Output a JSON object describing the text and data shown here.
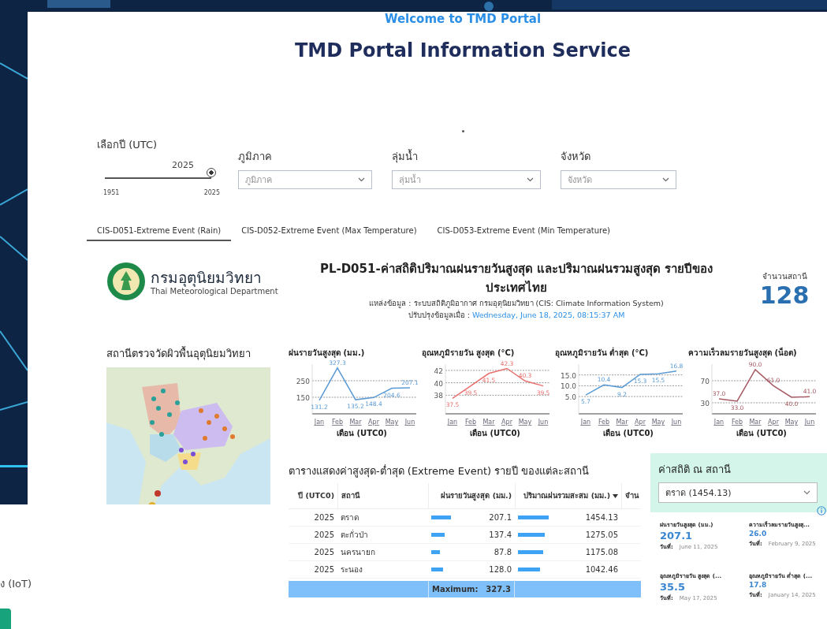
{
  "header": {
    "welcome": "Welcome to TMD Portal",
    "title": "TMD Portal Information Service"
  },
  "year_filter": {
    "label": "เลือกปี (UTC)",
    "value": "2025",
    "min": "1951",
    "max": "2025",
    "level": 1
  },
  "filters": [
    {
      "label": "ภูมิภาค",
      "placeholder": "ภูมิภาค"
    },
    {
      "label": "ลุ่มน้ำ",
      "placeholder": "ลุ่มน้ำ"
    },
    {
      "label": "จังหวัด",
      "placeholder": "จังหวัด"
    }
  ],
  "tabs": [
    {
      "label": "CIS-D051-Extreme Event (Rain)",
      "selected": true
    },
    {
      "label": "CIS-D052-Extreme Event (Max Temperature)",
      "selected": false
    },
    {
      "label": "CIS-D053-Extreme Event (Min Temperature)",
      "selected": false
    }
  ],
  "report": {
    "org_name": "กรมอุตุนิยมวิทยา",
    "org_name_en": "Thai Meteorological Department",
    "title": "PL-D051-ค่าสถิติปริมาณฝนรายวันสูงสุด และปริมาณฝนรวมสูงสุด รายปีของประเทศไทย",
    "source": "แหล่งข้อมูล : ระบบสถิติภูมิอากาศ กรมอุตุนิยมวิทยา (CIS: Climate Information System)",
    "updated_label": "ปรับปรุงข้อมูลเมื่อ :",
    "updated": "Wednesday, June 18, 2025, 08:15:37 AM",
    "station_count_label": "จำนวนสถานี",
    "station_count": "128"
  },
  "map": {
    "title": "สถานีตรวจวัดผิวพื้นอุตุนิยมวิทยา",
    "kind": "picture"
  },
  "charts": [
    {
      "chart_data": {
        "type": "line",
        "title": "ฝนรายวันสูงสุด (มม.)",
        "xlabel": "เดือน (UTC0)",
        "categories": [
          "Jan",
          "Feb",
          "Mar",
          "Apr",
          "May",
          "Jun"
        ],
        "grid": true,
        "ylim": [
          50,
          350
        ],
        "yticks": [
          150,
          250
        ],
        "series": [
          {
            "color": "#5b9bd5",
            "values": [
              131.2,
              327.3,
              135.2,
              148.4,
              204.6,
              207.1
            ],
            "value_labels": [
              "131.2",
              "327.3",
              "135.2",
              "148.4",
              "204.6",
              "207.1"
            ]
          }
        ]
      }
    },
    {
      "chart_data": {
        "type": "line",
        "title": "อุณหภูมิรายวัน สูงสุด (°C)",
        "xlabel": "เดือน (UTC0)",
        "categories": [
          "Jan",
          "Feb",
          "Mar",
          "Apr",
          "May",
          "Jun"
        ],
        "grid": true,
        "ylim": [
          35,
          43
        ],
        "yticks": [
          38,
          40,
          42
        ],
        "series": [
          {
            "color": "#e8706e",
            "values": [
              37.5,
              39.5,
              41.5,
              42.3,
              40.3,
              39.5
            ],
            "value_labels": [
              "37.5",
              "39.5",
              "41.5",
              "42.3",
              "40.3",
              "39.5"
            ]
          }
        ]
      }
    },
    {
      "chart_data": {
        "type": "line",
        "title": "อุณหภูมิรายวัน ต่ำสุด (°C)",
        "xlabel": "เดือน (UTC0)",
        "categories": [
          "Jan",
          "Feb",
          "Mar",
          "Apr",
          "May",
          "Jun"
        ],
        "grid": true,
        "ylim": [
          -3,
          20
        ],
        "yticks": [
          {
            "value": 5,
            "label": "5.0"
          },
          {
            "value": 10,
            "label": "10.0"
          },
          {
            "value": 15,
            "label": "15.0"
          }
        ],
        "series": [
          {
            "color": "#5b9bd5",
            "values": [
              5.7,
              10.4,
              9.2,
              15.3,
              15.5,
              16.8
            ],
            "value_labels": [
              "5.7",
              "10.4",
              "9.2",
              "15.3",
              "15.5",
              "16.8"
            ]
          }
        ]
      }
    },
    {
      "chart_data": {
        "type": "line",
        "title": "ความเร็วลมรายวันสูงสุด (น็อต)",
        "xlabel": "เดือน (UTC0)",
        "categories": [
          "Jan",
          "Feb",
          "Mar",
          "Apr",
          "May",
          "Jun"
        ],
        "grid": true,
        "ylim": [
          10,
          100
        ],
        "yticks": [
          30,
          70
        ],
        "series": [
          {
            "color": "#a65a63",
            "values": [
              37.0,
              33.0,
              90.0,
              61.0,
              40.0,
              41.0
            ],
            "value_labels": [
              "37.0",
              "33.0",
              "90.0",
              "61.0",
              "40.0",
              "41.0"
            ]
          }
        ]
      }
    }
  ],
  "table": {
    "title": "ตารางแสดงค่าสูงสุด-ต่ำสุด (Extreme Event) รายปี ของแต่ละสถานี",
    "columns": [
      "ปี (UTC0)",
      "สถานี",
      "ฝนรายวันสูงสุด (มม.)",
      "ปริมาณฝนรวมสะสม (มม.)",
      "จำน"
    ],
    "rows": [
      {
        "year": "2025",
        "station": "ตราด",
        "rain_max": "207.1",
        "rain_total": "1454.13"
      },
      {
        "year": "2025",
        "station": "ตะกั่วป่า",
        "rain_max": "137.4",
        "rain_total": "1275.05"
      },
      {
        "year": "2025",
        "station": "นครนายก",
        "rain_max": "87.8",
        "rain_total": "1175.08"
      },
      {
        "year": "2025",
        "station": "ระนอง",
        "rain_max": "128.0",
        "rain_total": "1042.46"
      }
    ],
    "footer_label": "Maximum:",
    "footer_value": "327.3"
  },
  "station_stats": {
    "title": "ค่าสถิติ ณ สถานี",
    "selected_station": "ตราด (1454.13)",
    "items": [
      {
        "label": "ฝนรายวันสูงสุด (มม.)",
        "value": "207.1",
        "date_label": "วันที่:",
        "date": "June 11, 2025",
        "kind": "large"
      },
      {
        "label": "ความเร็วลมรายวันสูงสุ...",
        "value": "26.0",
        "date_label": "วันที่:",
        "date": "February 9, 2025",
        "kind": "small"
      },
      {
        "label": "อุณหภูมิรายวัน สูงสุด (...",
        "value": "35.5",
        "date_label": "วันที่:",
        "date": "May 17, 2025",
        "kind": "large"
      },
      {
        "label": "อุณหภูมิรายวัน ต่ำสุด (...",
        "value": "17.8",
        "date_label": "วันที่:",
        "date": "January 14, 2025",
        "kind": "small"
      }
    ]
  },
  "background_page": {
    "text": "ง (IoT)"
  }
}
